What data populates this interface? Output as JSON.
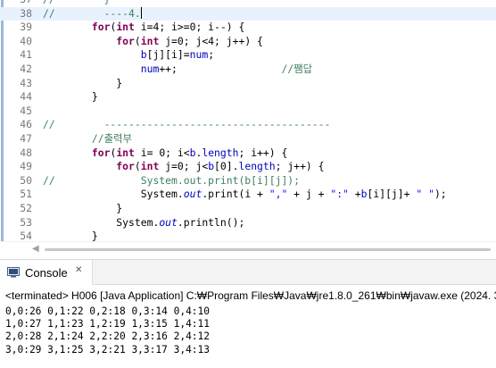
{
  "editor": {
    "lines": [
      {
        "num": "37",
        "tokens": [
          {
            "t": "cm",
            "v": "//"
          },
          {
            "t": "cm",
            "v": "        }"
          }
        ]
      },
      {
        "num": "38",
        "tokens": [
          {
            "t": "cm",
            "v": "//        ----4."
          }
        ],
        "caret": true
      },
      {
        "num": "39",
        "tokens": [
          {
            "t": "tx",
            "v": "        "
          },
          {
            "t": "kw",
            "v": "for"
          },
          {
            "t": "tx",
            "v": "("
          },
          {
            "t": "kw",
            "v": "int"
          },
          {
            "t": "tx",
            "v": " i=4; i>=0; i--) {"
          }
        ]
      },
      {
        "num": "40",
        "tokens": [
          {
            "t": "tx",
            "v": "            "
          },
          {
            "t": "kw",
            "v": "for"
          },
          {
            "t": "tx",
            "v": "("
          },
          {
            "t": "kw",
            "v": "int"
          },
          {
            "t": "tx",
            "v": " j=0; j<4; j++) {"
          }
        ]
      },
      {
        "num": "41",
        "tokens": [
          {
            "t": "fld",
            "v": "                b"
          },
          {
            "t": "tx",
            "v": "[j][i]="
          },
          {
            "t": "fld",
            "v": "num"
          },
          {
            "t": "tx",
            "v": ";"
          }
        ]
      },
      {
        "num": "42",
        "tokens": [
          {
            "t": "fld",
            "v": "                num"
          },
          {
            "t": "tx",
            "v": "++;                 "
          },
          {
            "t": "cm",
            "v": "//쨈답"
          }
        ]
      },
      {
        "num": "43",
        "tokens": [
          {
            "t": "tx",
            "v": "            }"
          }
        ]
      },
      {
        "num": "44",
        "tokens": [
          {
            "t": "tx",
            "v": "        }"
          }
        ]
      },
      {
        "num": "45",
        "tokens": [
          {
            "t": "tx",
            "v": ""
          }
        ]
      },
      {
        "num": "46",
        "tokens": [
          {
            "t": "cm",
            "v": "//        -------------------------------------"
          }
        ]
      },
      {
        "num": "47",
        "tokens": [
          {
            "t": "cm",
            "v": "        //출력부"
          }
        ]
      },
      {
        "num": "48",
        "tokens": [
          {
            "t": "tx",
            "v": "        "
          },
          {
            "t": "kw",
            "v": "for"
          },
          {
            "t": "tx",
            "v": "("
          },
          {
            "t": "kw",
            "v": "int"
          },
          {
            "t": "tx",
            "v": " i= 0; i<"
          },
          {
            "t": "fld",
            "v": "b"
          },
          {
            "t": "tx",
            "v": "."
          },
          {
            "t": "fld",
            "v": "length"
          },
          {
            "t": "tx",
            "v": "; i++) {"
          }
        ]
      },
      {
        "num": "49",
        "tokens": [
          {
            "t": "tx",
            "v": "            "
          },
          {
            "t": "kw",
            "v": "for"
          },
          {
            "t": "tx",
            "v": "("
          },
          {
            "t": "kw",
            "v": "int"
          },
          {
            "t": "tx",
            "v": " j=0; j<"
          },
          {
            "t": "fld",
            "v": "b"
          },
          {
            "t": "tx",
            "v": "[0]."
          },
          {
            "t": "fld",
            "v": "length"
          },
          {
            "t": "tx",
            "v": "; j++) {"
          }
        ]
      },
      {
        "num": "50",
        "tokens": [
          {
            "t": "cm",
            "v": "//              System.out.print(b[i][j]);"
          }
        ]
      },
      {
        "num": "51",
        "tokens": [
          {
            "t": "tx",
            "v": "                System."
          },
          {
            "t": "fldit",
            "v": "out"
          },
          {
            "t": "tx",
            "v": ".print(i + "
          },
          {
            "t": "st",
            "v": "\",\""
          },
          {
            "t": "tx",
            "v": " + j + "
          },
          {
            "t": "st",
            "v": "\":\""
          },
          {
            "t": "tx",
            "v": " +"
          },
          {
            "t": "fld",
            "v": "b"
          },
          {
            "t": "tx",
            "v": "[i][j]+ "
          },
          {
            "t": "st",
            "v": "\" \""
          },
          {
            "t": "tx",
            "v": ");"
          }
        ]
      },
      {
        "num": "52",
        "tokens": [
          {
            "t": "tx",
            "v": "            }"
          }
        ]
      },
      {
        "num": "53",
        "tokens": [
          {
            "t": "tx",
            "v": "            System."
          },
          {
            "t": "fldit",
            "v": "out"
          },
          {
            "t": "tx",
            "v": ".println();"
          }
        ]
      },
      {
        "num": "54",
        "tokens": [
          {
            "t": "tx",
            "v": "        }"
          }
        ]
      }
    ]
  },
  "console": {
    "tab_label": "Console",
    "tab_close": "✕",
    "status": "<terminated> H006 [Java Application] C:₩Program Files₩Java₩jre1.8.0_261₩bin₩javaw.exe (2024. 3.",
    "output": [
      "0,0:26 0,1:22 0,2:18 0,3:14 0,4:10",
      "1,0:27 1,1:23 1,2:19 1,3:15 1,4:11",
      "2,0:28 2,1:24 2,2:20 2,3:16 2,4:12",
      "3,0:29 3,1:25 3,2:21 3,3:17 3,4:13"
    ]
  },
  "colors": {
    "keyword": "#7f0055",
    "comment": "#3f7f5f",
    "string": "#2a00ff",
    "field": "#0000c0",
    "current_line": "#e8f2fe"
  },
  "icons": {
    "console_tab": "console-monitor-icon",
    "scroll_left": "scroll-left-arrow-icon"
  }
}
